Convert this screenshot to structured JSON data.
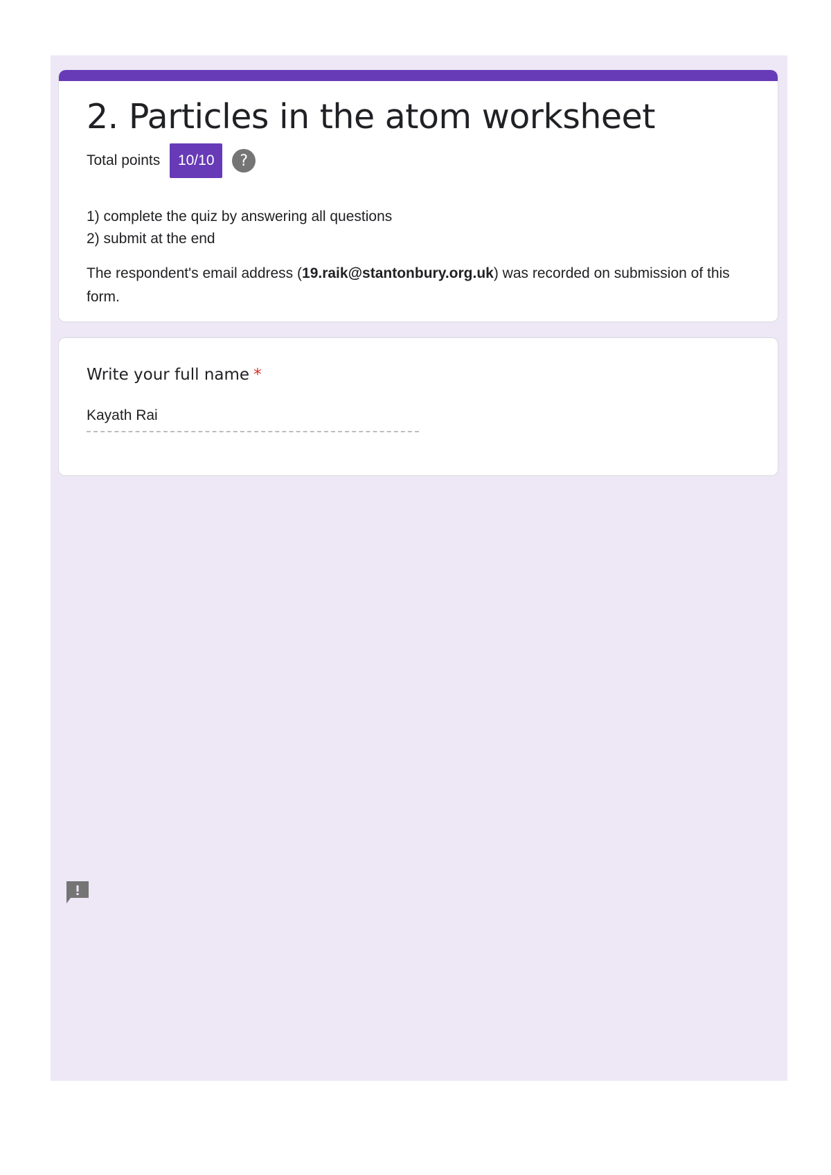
{
  "form": {
    "title": "2. Particles in the atom worksheet",
    "points_label": "Total points",
    "points_value": "10/10",
    "help_icon": "question-mark-icon",
    "help_glyph": "?",
    "instructions": [
      "1) complete the quiz by answering all questions",
      "2) submit at the end"
    ],
    "email_note_prefix": "The respondent's email address (",
    "email": "19.raik@stantonbury.org.uk",
    "email_note_suffix": ") was recorded on submission of this form."
  },
  "question": {
    "title": "Write your full name",
    "required_mark": "*",
    "answer": "Kayath Rai"
  },
  "feedback": {
    "icon": "report-feedback-icon"
  },
  "colors": {
    "accent": "#673ab7",
    "background": "#ede7f6",
    "required": "#d93025",
    "help_icon": "#757575"
  }
}
